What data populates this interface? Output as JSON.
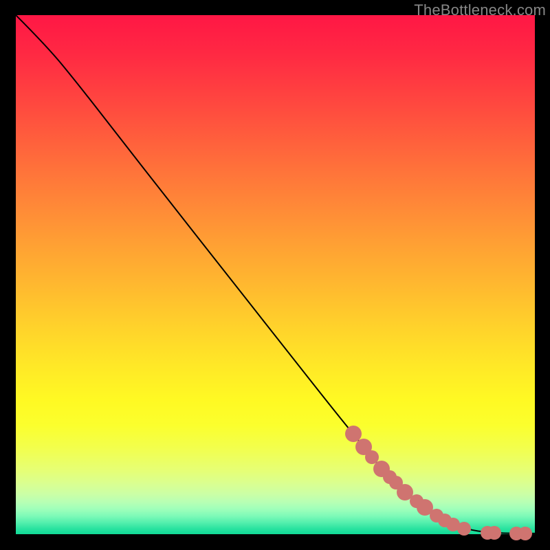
{
  "watermark": "TheBottleneck.com",
  "gradient_stops": [
    {
      "offset": 0.0,
      "color": "#ff1745"
    },
    {
      "offset": 0.075,
      "color": "#ff2943"
    },
    {
      "offset": 0.15,
      "color": "#ff4140"
    },
    {
      "offset": 0.225,
      "color": "#ff5a3d"
    },
    {
      "offset": 0.3,
      "color": "#ff733a"
    },
    {
      "offset": 0.375,
      "color": "#ff8b37"
    },
    {
      "offset": 0.45,
      "color": "#ffa333"
    },
    {
      "offset": 0.525,
      "color": "#ffba2f"
    },
    {
      "offset": 0.6,
      "color": "#ffd22b"
    },
    {
      "offset": 0.675,
      "color": "#ffe827"
    },
    {
      "offset": 0.742,
      "color": "#fff923"
    },
    {
      "offset": 0.79,
      "color": "#fbff2d"
    },
    {
      "offset": 0.835,
      "color": "#f2ff4e"
    },
    {
      "offset": 0.877,
      "color": "#e6ff75"
    },
    {
      "offset": 0.902,
      "color": "#daff90"
    },
    {
      "offset": 0.922,
      "color": "#ccffa5"
    },
    {
      "offset": 0.938,
      "color": "#b8ffb4"
    },
    {
      "offset": 0.952,
      "color": "#9effba"
    },
    {
      "offset": 0.965,
      "color": "#7dfab8"
    },
    {
      "offset": 0.978,
      "color": "#53efad"
    },
    {
      "offset": 0.99,
      "color": "#28e29f"
    },
    {
      "offset": 1.0,
      "color": "#10db97"
    }
  ],
  "chart_data": {
    "type": "line",
    "title": "",
    "xlabel": "",
    "ylabel": "",
    "xlim": [
      0,
      100
    ],
    "ylim": [
      0,
      100
    ],
    "grid": false,
    "curve": [
      {
        "x": 0.0,
        "y": 100.0
      },
      {
        "x": 6.0,
        "y": 94.0
      },
      {
        "x": 12.0,
        "y": 86.7
      },
      {
        "x": 20.0,
        "y": 76.4
      },
      {
        "x": 30.0,
        "y": 63.6
      },
      {
        "x": 40.0,
        "y": 50.9
      },
      {
        "x": 50.0,
        "y": 38.2
      },
      {
        "x": 60.0,
        "y": 25.5
      },
      {
        "x": 65.0,
        "y": 19.3
      },
      {
        "x": 70.0,
        "y": 13.1
      },
      {
        "x": 75.0,
        "y": 8.1
      },
      {
        "x": 80.0,
        "y": 4.2
      },
      {
        "x": 84.0,
        "y": 1.9
      },
      {
        "x": 88.0,
        "y": 0.7
      },
      {
        "x": 92.0,
        "y": 0.25
      },
      {
        "x": 96.0,
        "y": 0.15
      },
      {
        "x": 100.0,
        "y": 0.15
      }
    ],
    "markers": [
      {
        "x": 65.0,
        "y": 19.3,
        "r": 12
      },
      {
        "x": 67.0,
        "y": 16.8,
        "r": 12
      },
      {
        "x": 68.6,
        "y": 14.8,
        "r": 10
      },
      {
        "x": 70.4,
        "y": 12.6,
        "r": 12
      },
      {
        "x": 72.0,
        "y": 11.0,
        "r": 10
      },
      {
        "x": 73.2,
        "y": 9.9,
        "r": 10
      },
      {
        "x": 75.0,
        "y": 8.1,
        "r": 12
      },
      {
        "x": 77.2,
        "y": 6.3,
        "r": 10
      },
      {
        "x": 78.8,
        "y": 5.1,
        "r": 12
      },
      {
        "x": 81.0,
        "y": 3.6,
        "r": 10
      },
      {
        "x": 82.6,
        "y": 2.7,
        "r": 10
      },
      {
        "x": 84.2,
        "y": 1.9,
        "r": 10
      },
      {
        "x": 86.4,
        "y": 1.0,
        "r": 10
      },
      {
        "x": 90.8,
        "y": 0.3,
        "r": 10
      },
      {
        "x": 92.2,
        "y": 0.25,
        "r": 10
      },
      {
        "x": 96.4,
        "y": 0.15,
        "r": 10
      },
      {
        "x": 98.2,
        "y": 0.15,
        "r": 10
      }
    ]
  },
  "colors": {
    "curve": "#000000",
    "marker": "#cf7470",
    "watermark": "#878787",
    "background": "#000000"
  }
}
